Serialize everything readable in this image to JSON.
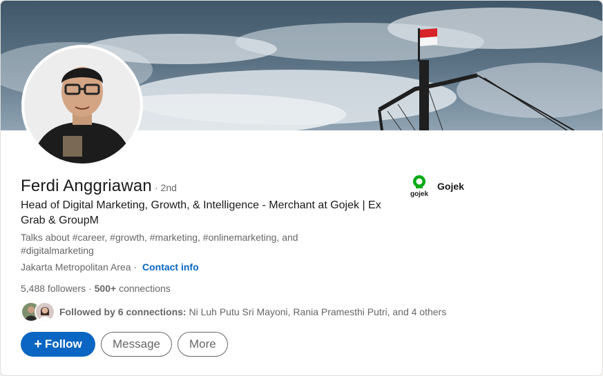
{
  "profile": {
    "name": "Ferdi Anggriawan",
    "degree": "· 2nd",
    "headline": "Head of Digital Marketing, Growth, & Intelligence - Merchant at Gojek | Ex Grab & GroupM",
    "talks_about": "Talks about #career, #growth, #marketing, #onlinemarketing, and #digitalmarketing",
    "location": "Jakarta Metropolitan Area ·",
    "contact_info_label": "Contact info",
    "followers": "5,488 followers",
    "connections_count": "500+",
    "connections_label": "connections",
    "followed_by_bold": "Followed by 6 connections:",
    "followed_by_rest": "Ni Luh Putu Sri Mayoni, Rania Pramesthi Putri, and 4 others"
  },
  "company": {
    "name": "Gojek",
    "logo_text": "gojek",
    "logo_color": "#00aa13"
  },
  "actions": {
    "follow_label": "Follow",
    "message_label": "Message",
    "more_label": "More"
  },
  "colors": {
    "accent": "#0a66c2",
    "muted_text": "#666666"
  }
}
